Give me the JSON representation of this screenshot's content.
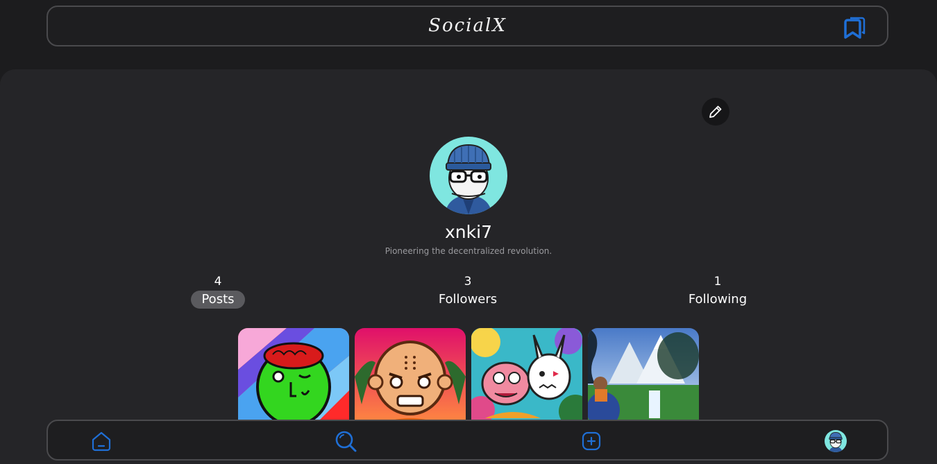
{
  "header": {
    "logo": "SocialX",
    "bookmark_icon": "bookmark-stack-icon",
    "accent": "#1f6fd6"
  },
  "profile": {
    "edit_icon": "pencil-icon",
    "username": "xnki7",
    "bio": "Pioneering the decentralized revolution.",
    "avatar_icon": "beanie-glasses-avatar"
  },
  "stats": [
    {
      "count": "4",
      "label": "Posts",
      "active": true
    },
    {
      "count": "3",
      "label": "Followers",
      "active": false
    },
    {
      "count": "1",
      "label": "Following",
      "active": false
    }
  ],
  "posts": [
    {
      "icon": "green-brain-character-image"
    },
    {
      "icon": "bald-monk-character-image"
    },
    {
      "icon": "colorful-monsters-image"
    },
    {
      "icon": "fantasy-landscape-image"
    }
  ],
  "bottom_nav": [
    {
      "icon": "home-icon"
    },
    {
      "icon": "search-icon"
    },
    {
      "icon": "add-post-icon"
    },
    {
      "icon": "profile-avatar-icon"
    }
  ]
}
